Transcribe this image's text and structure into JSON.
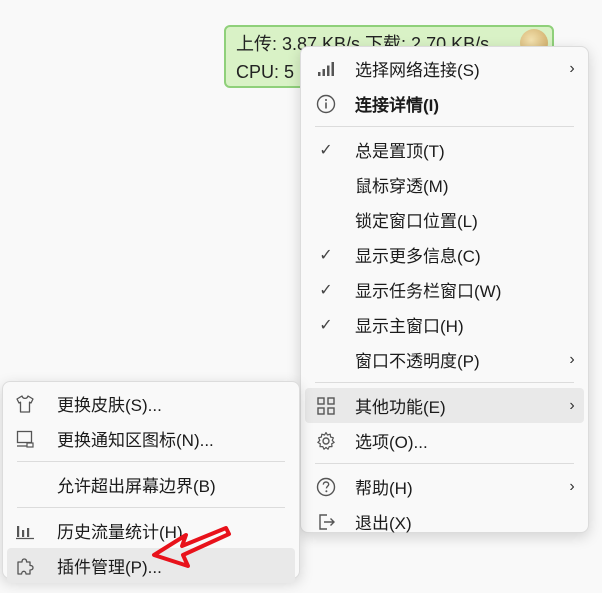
{
  "widget": {
    "line1": "上传: 3.87 KB/s   下载: 2.70 KB/s",
    "line2": "CPU: 5"
  },
  "main_menu": {
    "items": [
      {
        "label": "选择网络连接(S)",
        "icon": "signal-bars-icon",
        "submenu": true
      },
      {
        "label": "连接详情(I)",
        "icon": "info-circle-icon",
        "bold": true
      },
      {
        "label": "总是置顶(T)",
        "checked": true
      },
      {
        "label": "鼠标穿透(M)"
      },
      {
        "label": "锁定窗口位置(L)"
      },
      {
        "label": "显示更多信息(C)",
        "checked": true
      },
      {
        "label": "显示任务栏窗口(W)",
        "checked": true
      },
      {
        "label": "显示主窗口(H)",
        "checked": true
      },
      {
        "label": "窗口不透明度(P)",
        "submenu": true
      },
      {
        "label": "其他功能(E)",
        "icon": "grid-icon",
        "submenu": true,
        "highlighted": true
      },
      {
        "label": "选项(O)...",
        "icon": "gear-icon"
      },
      {
        "label": "帮助(H)",
        "icon": "help-circle-icon",
        "submenu": true
      },
      {
        "label": "退出(X)",
        "icon": "exit-icon"
      }
    ],
    "arrow_glyph": "›",
    "check_glyph": "✓"
  },
  "sub_menu": {
    "items": [
      {
        "label": "更换皮肤(S)...",
        "icon": "shirt-icon"
      },
      {
        "label": "更换通知区图标(N)...",
        "icon": "tray-icon"
      },
      {
        "label": "允许超出屏幕边界(B)"
      },
      {
        "label": "历史流量统计(H)",
        "icon": "bar-chart-icon"
      },
      {
        "label": "插件管理(P)...",
        "icon": "puzzle-icon",
        "highlighted": true
      }
    ]
  },
  "colors": {
    "widget_bg": "#d9f2c6",
    "widget_border": "#8fd07a",
    "annotation_arrow": "#e8121b"
  }
}
